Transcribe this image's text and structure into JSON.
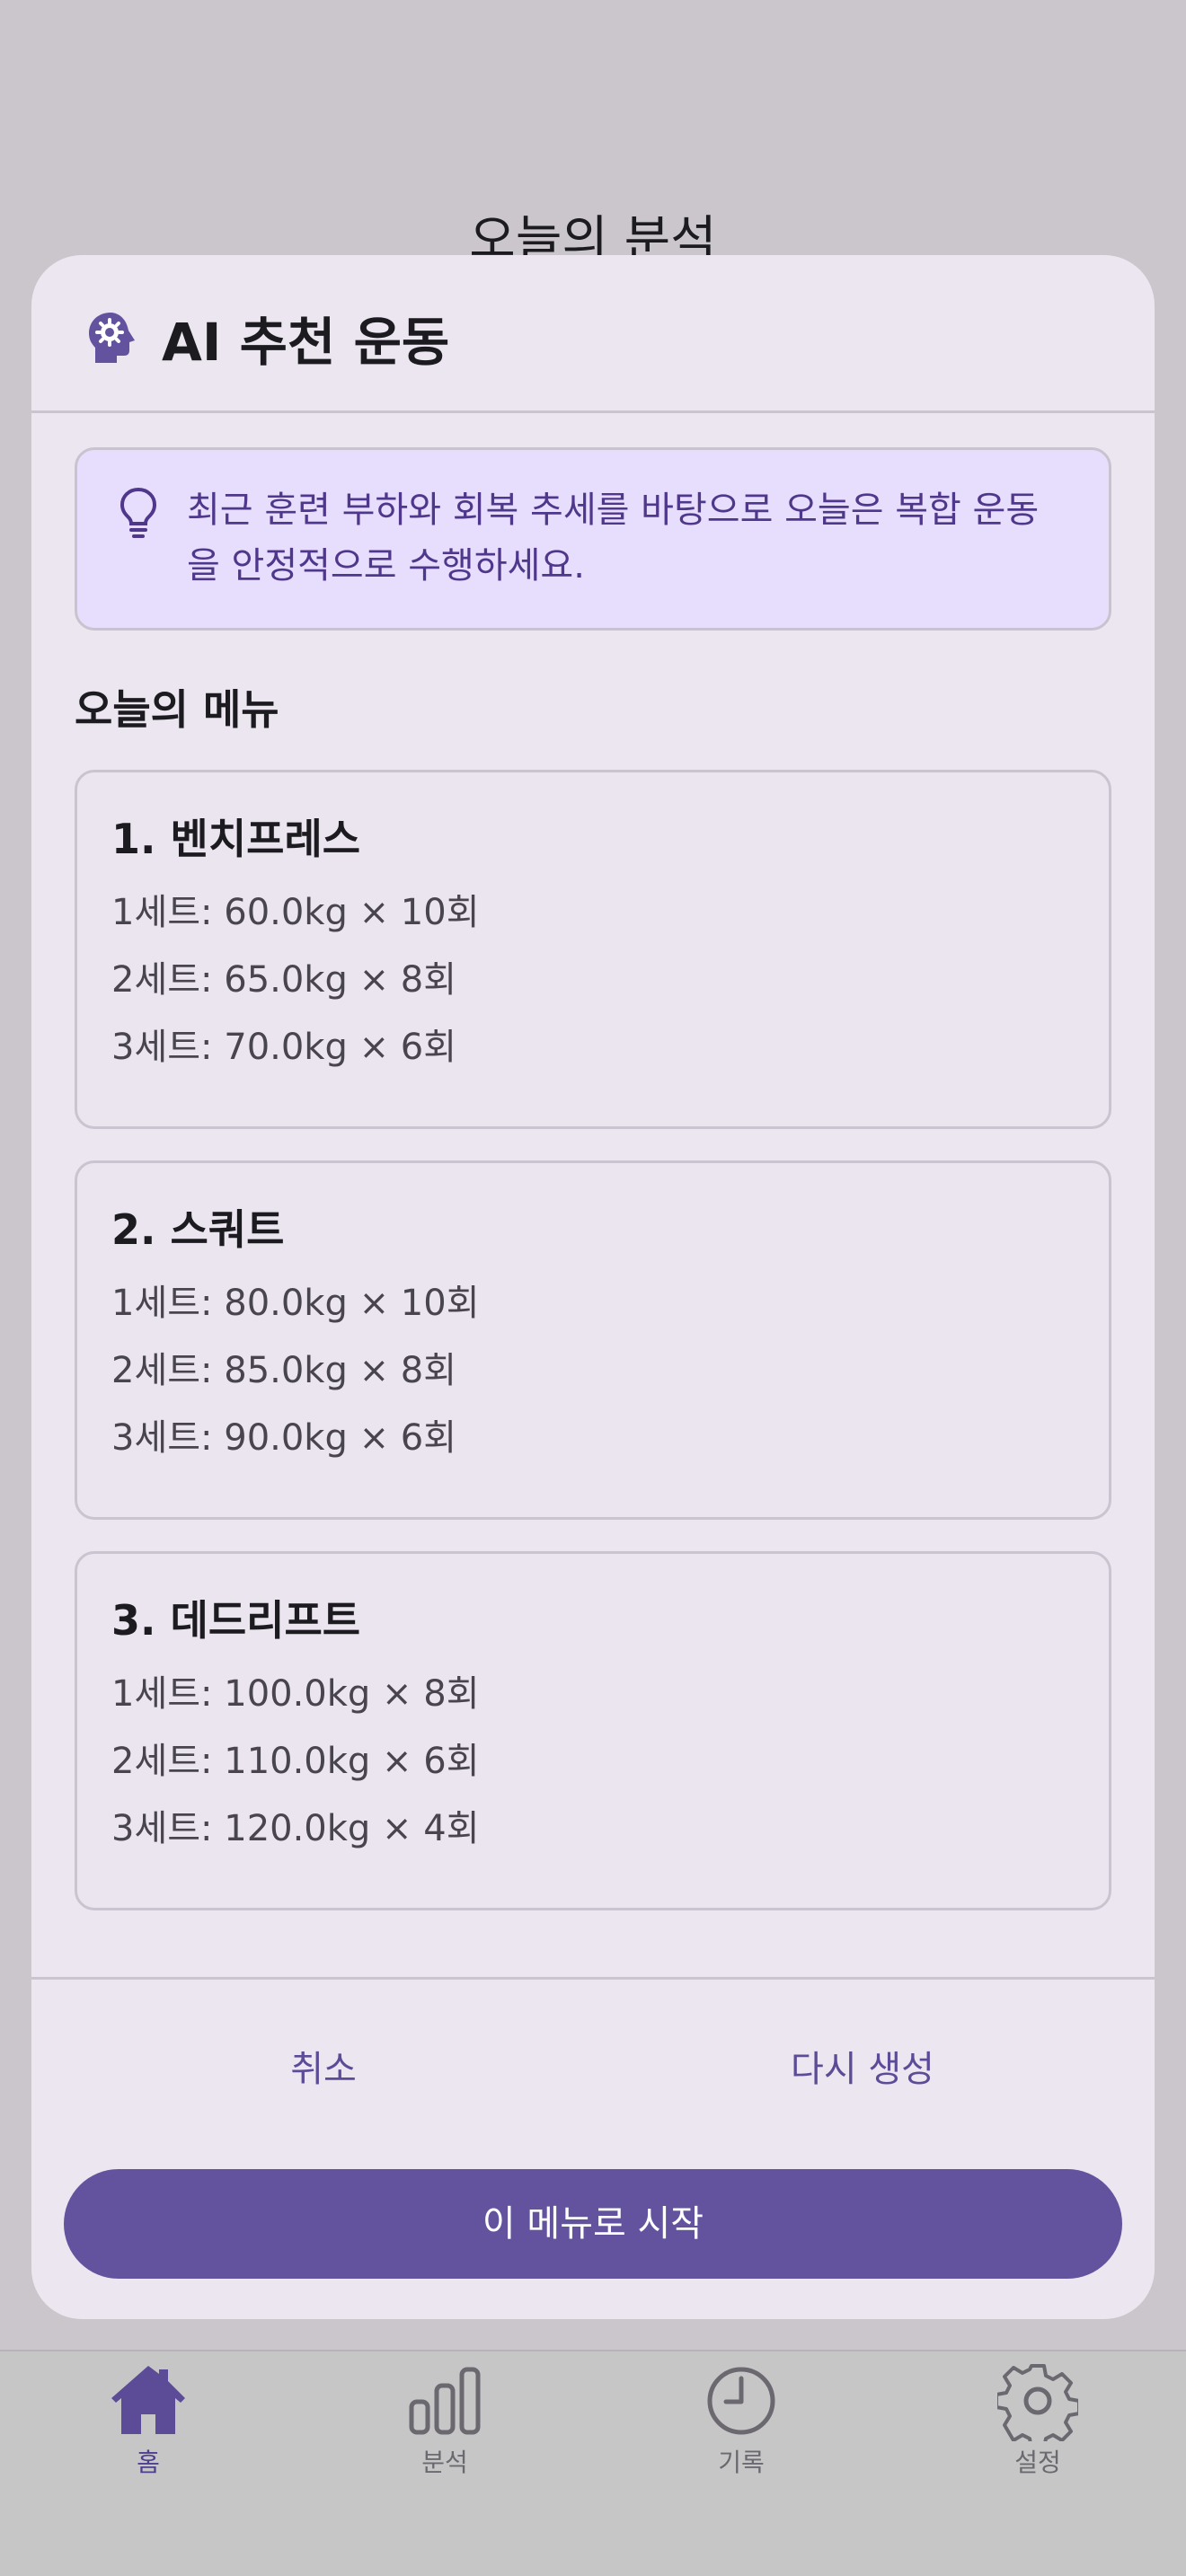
{
  "background": {
    "title": "오늘의 분석"
  },
  "dialog": {
    "title": "AI 추천 운동",
    "icon": "head-gear-icon",
    "hint": "최근 훈련 부하와 회복 추세를 바탕으로 오늘은 복합 운동을 안정적으로 수행하세요.",
    "section_title": "오늘의 메뉴",
    "exercises": [
      {
        "name": "1. 벤치프레스",
        "sets": [
          "1세트: 60.0kg × 10회",
          "2세트: 65.0kg × 8회",
          "3세트: 70.0kg × 6회"
        ]
      },
      {
        "name": "2. 스쿼트",
        "sets": [
          "1세트: 80.0kg × 10회",
          "2세트: 85.0kg × 8회",
          "3세트: 90.0kg × 6회"
        ]
      },
      {
        "name": "3. 데드리프트",
        "sets": [
          "1세트: 100.0kg × 8회",
          "2세트: 110.0kg × 6회",
          "3세트: 120.0kg × 4회"
        ]
      }
    ],
    "cancel_label": "취소",
    "regenerate_label": "다시 생성",
    "start_label": "이 메뉴로 시작"
  },
  "nav": {
    "items": [
      {
        "label": "홈",
        "icon": "home-icon",
        "active": true
      },
      {
        "label": "분석",
        "icon": "bar-chart-icon",
        "active": false
      },
      {
        "label": "기록",
        "icon": "clock-icon",
        "active": false
      },
      {
        "label": "설정",
        "icon": "gear-icon",
        "active": false
      }
    ]
  },
  "colors": {
    "accent": "#63529e",
    "hint_background": "#e7defd",
    "dialog_background": "#ece6f1",
    "scrim": "#cbc6cc"
  }
}
